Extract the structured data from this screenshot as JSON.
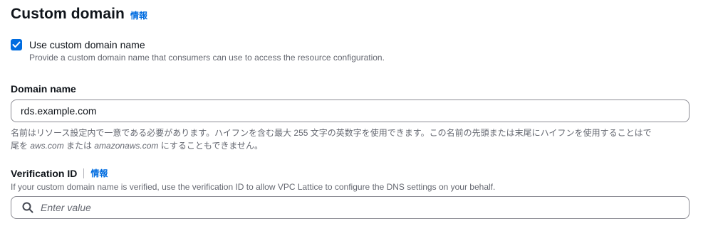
{
  "section": {
    "title": "Custom domain",
    "info_label": "情報"
  },
  "custom_domain_checkbox": {
    "label": "Use custom domain name",
    "description": "Provide a custom domain name that consumers can use to access the resource configuration.",
    "checked": true
  },
  "domain_name": {
    "label": "Domain name",
    "value": "rds.example.com",
    "helper_line1": "名前はリソース設定内で一意である必要があります。ハイフンを含む最大 255 文字の英数字を使用できます。この名前の先頭または末尾にハイフンを使用することはで",
    "helper_line2_prefix": "尾を ",
    "helper_line2_domain1": "aws.com",
    "helper_line2_middle": " または ",
    "helper_line2_domain2": "amazonaws.com",
    "helper_line2_suffix": " にすることもできません。"
  },
  "verification_id": {
    "label": "Verification ID",
    "info_label": "情報",
    "description": "If your custom domain name is verified, use the verification ID to allow VPC Lattice to configure the DNS settings on your behalf.",
    "placeholder": "Enter value"
  },
  "colors": {
    "accent": "#006ce0",
    "text": "#0f141a",
    "muted": "#656871",
    "border": "#8c8c94"
  },
  "icons": {
    "checkbox": "check-icon",
    "search": "search-icon"
  }
}
